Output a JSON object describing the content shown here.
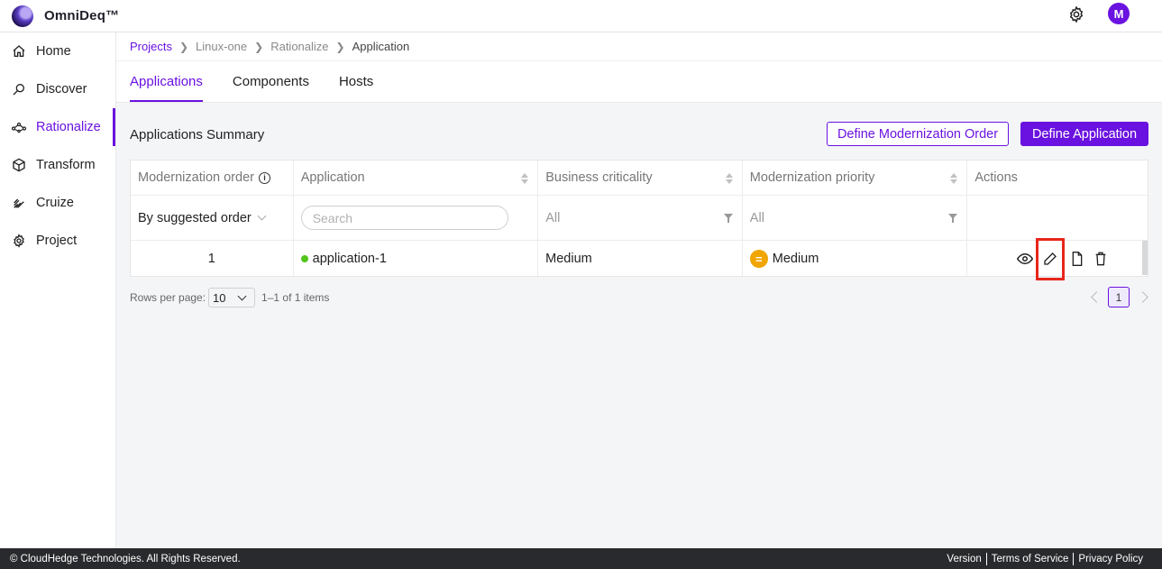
{
  "app": {
    "brand": "OmniDeq™",
    "avatar_initial": "M",
    "accent": "#6a12e0"
  },
  "sidebar": {
    "items": [
      {
        "label": "Home",
        "icon": "home-icon"
      },
      {
        "label": "Discover",
        "icon": "discover-icon"
      },
      {
        "label": "Rationalize",
        "icon": "rationalize-icon",
        "active": true
      },
      {
        "label": "Transform",
        "icon": "cube-icon"
      },
      {
        "label": "Cruize",
        "icon": "cruize-icon"
      },
      {
        "label": "Project",
        "icon": "gear-icon"
      }
    ]
  },
  "breadcrumb": [
    "Projects",
    "Linux-one",
    "Rationalize",
    "Application"
  ],
  "tabs": [
    "Applications",
    "Components",
    "Hosts"
  ],
  "summary": {
    "title": "Applications Summary",
    "btn_order": "Define Modernization Order",
    "btn_define": "Define Application"
  },
  "table": {
    "columns": [
      "Modernization order",
      "Application",
      "Business criticality",
      "Modernization priority",
      "Actions"
    ],
    "filters": {
      "order": "By suggested order",
      "search_placeholder": "Search",
      "criticality": "All",
      "priority": "All"
    },
    "rows": [
      {
        "order": "1",
        "application": "application-1",
        "criticality": "Medium",
        "priority": "Medium",
        "status_color": "#52c41a",
        "priority_color": "#f0a500"
      }
    ]
  },
  "pagination": {
    "rows_label": "Rows per page:",
    "rows_value": "10",
    "range": "1–1 of 1 items",
    "page": "1"
  },
  "footer": {
    "copyright": "© CloudHedge Technologies. All Rights Reserved.",
    "links": [
      "Version",
      "Terms of Service",
      "Privacy Policy"
    ]
  }
}
